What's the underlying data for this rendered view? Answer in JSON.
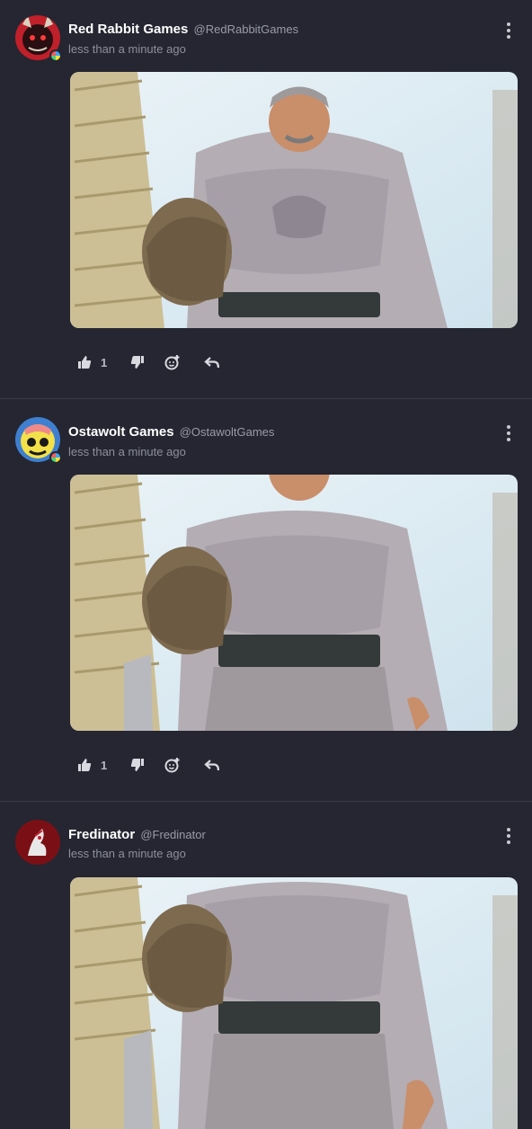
{
  "posts": [
    {
      "author": "Red Rabbit Games",
      "handle": "@RedRabbitGames",
      "timestamp": "less than a minute ago",
      "like_count": "1",
      "avatar_colors": [
        "#c0202a",
        "#2a0f12"
      ]
    },
    {
      "author": "Ostawolt Games",
      "handle": "@OstawoltGames",
      "timestamp": "less than a minute ago",
      "like_count": "1",
      "avatar_colors": [
        "#f2e14a",
        "#1a1a1a"
      ]
    },
    {
      "author": "Fredinator",
      "handle": "@Fredinator",
      "timestamp": "less than a minute ago",
      "avatar_colors": [
        "#7a1015",
        "#e8e8e8"
      ]
    }
  ],
  "icons": {
    "like": "thumbs-up-icon",
    "dislike": "thumbs-down-icon",
    "react": "add-reaction-icon",
    "reply": "reply-icon",
    "more": "more-options-icon"
  },
  "theme": {
    "background": "#252631",
    "divider": "#3a3b47",
    "text": "#ffffff",
    "muted": "#8e8f9c"
  }
}
